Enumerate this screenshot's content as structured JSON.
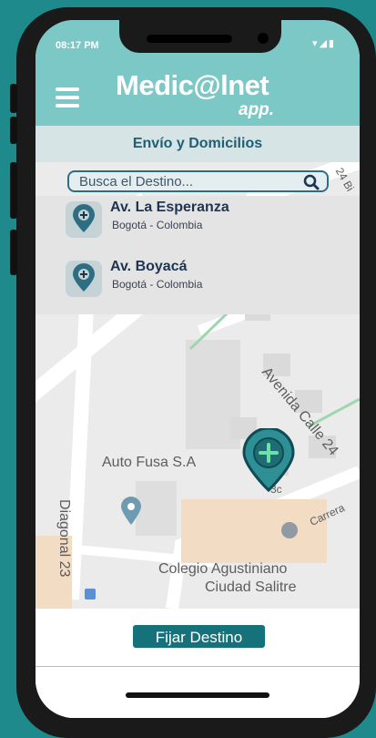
{
  "status_bar": {
    "time": "08:17 PM",
    "icons": "▾◢▮"
  },
  "app": {
    "logo_main": "Medic@lnet",
    "logo_sub": "app."
  },
  "header": {
    "title": "Envío y Domicilios"
  },
  "search": {
    "placeholder": "Busca el Destino..."
  },
  "results": [
    {
      "name": "Av. La Esperanza",
      "city": "Bogotá - Colombia"
    },
    {
      "name": "Av. Boyacá",
      "city": "Bogotá - Colombia"
    }
  ],
  "map": {
    "labels": {
      "street_24b": "24 Bi",
      "avenida_calle_24": "Avenida Calle 24",
      "auto_fusa": "Auto Fusa S.A",
      "diagonal_23": "Diagonal 23",
      "carrera": "Carrera",
      "colegio_line1": "Colegio Agustiniano",
      "colegio_line2": "Ciudad Salitre",
      "street_3c": "3c"
    }
  },
  "actions": {
    "fijar_destino": "Fijar Destino"
  },
  "colors": {
    "teal": "#7cc8c7",
    "dark_teal": "#16727a",
    "navy": "#1f5f74"
  }
}
